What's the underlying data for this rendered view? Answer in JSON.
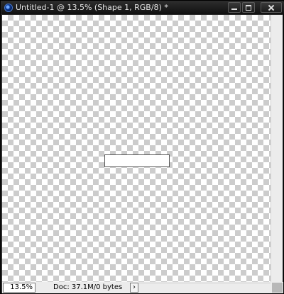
{
  "window": {
    "title": "Untitled-1 @ 13.5% (Shape 1, RGB/8) *"
  },
  "icons": {
    "app": "photoshop-app-icon",
    "minimize": "minimize-icon",
    "maximize": "maximize-icon",
    "close": "close-icon",
    "info_arrow": "chevron-right-icon"
  },
  "status": {
    "zoom": "13.5%",
    "doc_info": "Doc: 37.1M/0 bytes",
    "arrow_glyph": "›"
  },
  "colors": {
    "titlebar": "#1a1a1a",
    "checker_dark": "#cccccc",
    "checker_light": "#ffffff",
    "statusbar": "#ececec"
  }
}
